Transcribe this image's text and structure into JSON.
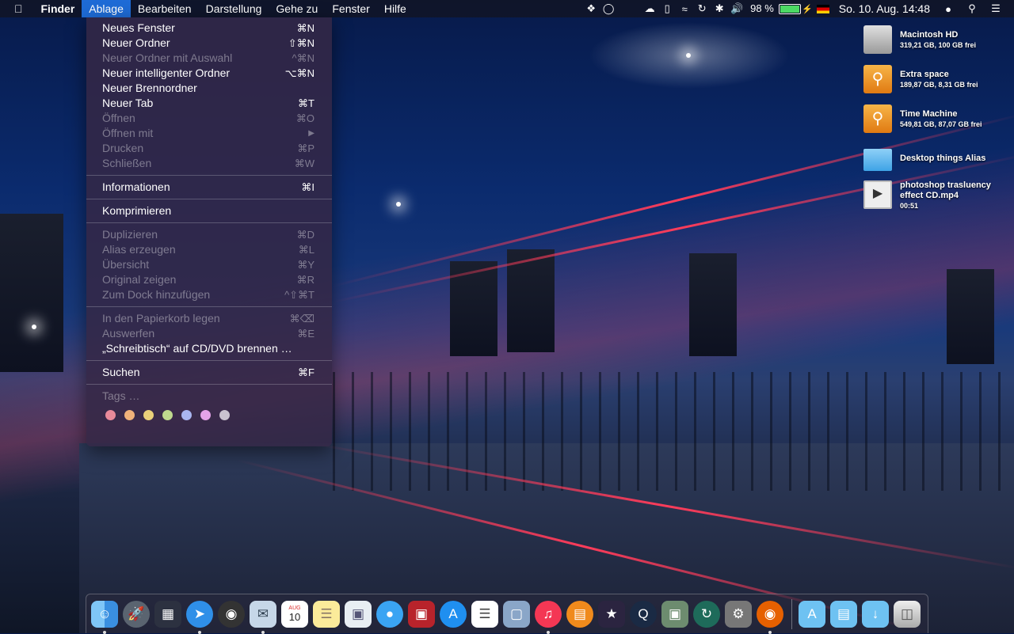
{
  "menubar": {
    "apple_icon": "apple-icon",
    "app_name": "Finder",
    "menus": [
      "Ablage",
      "Bearbeiten",
      "Darstellung",
      "Gehe zu",
      "Fenster",
      "Hilfe"
    ],
    "battery_percent": "98 %",
    "battery_level": 0.98,
    "date_time": "So. 10. Aug.  14:48"
  },
  "file_menu": {
    "items": [
      {
        "label": "Neues Fenster",
        "shortcut": "⌘N",
        "enabled": true
      },
      {
        "label": "Neuer Ordner",
        "shortcut": "⇧⌘N",
        "enabled": true
      },
      {
        "label": "Neuer Ordner mit Auswahl",
        "shortcut": "^⌘N",
        "enabled": false
      },
      {
        "label": "Neuer intelligenter Ordner",
        "shortcut": "⌥⌘N",
        "enabled": true
      },
      {
        "label": "Neuer Brennordner",
        "shortcut": "",
        "enabled": true
      },
      {
        "label": "Neuer Tab",
        "shortcut": "⌘T",
        "enabled": true
      },
      {
        "label": "Öffnen",
        "shortcut": "⌘O",
        "enabled": false
      },
      {
        "label": "Öffnen mit",
        "shortcut": "▶",
        "enabled": false
      },
      {
        "label": "Drucken",
        "shortcut": "⌘P",
        "enabled": false
      },
      {
        "label": "Schließen",
        "shortcut": "⌘W",
        "enabled": false
      },
      {
        "label": "Informationen",
        "shortcut": "⌘I",
        "enabled": true
      },
      {
        "label": "Komprimieren",
        "shortcut": "",
        "enabled": true
      },
      {
        "label": "Duplizieren",
        "shortcut": "⌘D",
        "enabled": false
      },
      {
        "label": "Alias erzeugen",
        "shortcut": "⌘L",
        "enabled": false
      },
      {
        "label": "Übersicht",
        "shortcut": "⌘Y",
        "enabled": false
      },
      {
        "label": "Original zeigen",
        "shortcut": "⌘R",
        "enabled": false
      },
      {
        "label": "Zum Dock hinzufügen",
        "shortcut": "^⇧⌘T",
        "enabled": false
      },
      {
        "label": "In den Papierkorb legen",
        "shortcut": "⌘⌫",
        "enabled": false
      },
      {
        "label": "Auswerfen",
        "shortcut": "⌘E",
        "enabled": false
      },
      {
        "label": "„Schreibtisch“ auf CD/DVD brennen …",
        "shortcut": "",
        "enabled": true
      },
      {
        "label": "Suchen",
        "shortcut": "⌘F",
        "enabled": true
      },
      {
        "label": "Tags …",
        "shortcut": "",
        "enabled": false
      }
    ],
    "tag_colors": [
      "#e98a9a",
      "#f0b27a",
      "#ead07a",
      "#bfd98e",
      "#a9b6f0",
      "#e4a3e8",
      "#c9c2cf"
    ]
  },
  "desktop": {
    "icons": [
      {
        "name": "Macintosh HD",
        "detail": "319,21 GB, 100 GB frei",
        "icon": "harddisk-icon"
      },
      {
        "name": "Extra space",
        "detail": "189,87 GB, 8,31 GB frei",
        "icon": "usb-drive-icon"
      },
      {
        "name": "Time Machine",
        "detail": "549,81 GB, 87,07 GB frei",
        "icon": "usb-drive-icon"
      },
      {
        "name": "Desktop things Alias",
        "detail": "",
        "icon": "folder-alias-icon"
      },
      {
        "name": "photoshop trasluency effect CD.mp4",
        "detail": "00:51",
        "icon": "video-file-icon"
      }
    ]
  },
  "dock": {
    "calendar_month": "AUG",
    "calendar_day": "10",
    "apps": [
      "finder",
      "launchpad",
      "mission-control",
      "safari",
      "dashboard",
      "mail",
      "calendar",
      "notes",
      "preview",
      "messages",
      "photo-booth",
      "app-store",
      "reminders",
      "iphoto",
      "itunes",
      "ibooks",
      "imovie",
      "quicktime",
      "image-capture",
      "time-machine",
      "system-preferences",
      "firefox"
    ],
    "stacks": [
      "applications",
      "documents",
      "downloads",
      "trash"
    ]
  }
}
